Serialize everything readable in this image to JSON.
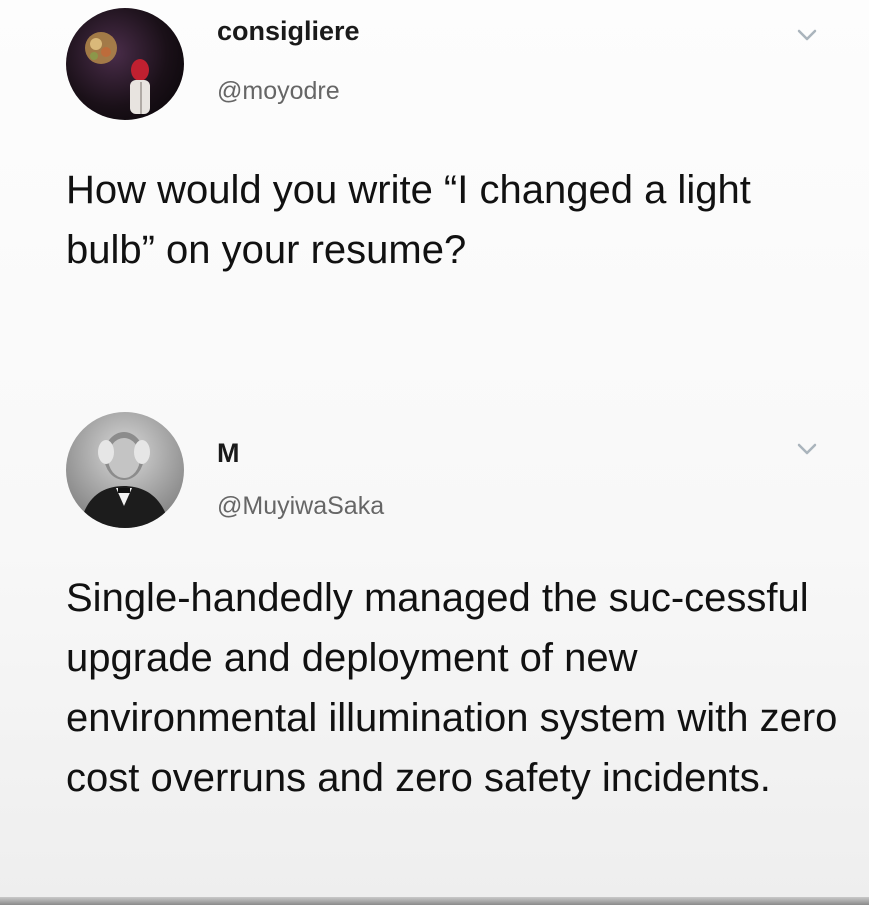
{
  "tweets": [
    {
      "display_name": "consigliere",
      "handle": "@moyodre",
      "text": "How would you write “I changed a light bulb” on your resume?",
      "avatar_icon": "avatar-photo-figure-with-balloon",
      "menu_icon": "chevron-down-icon"
    },
    {
      "display_name": "M",
      "handle": "@MuyiwaSaka",
      "text": "Single-handedly managed the suc-cessful upgrade and deployment of new environmental illumination system with zero cost overruns and zero safety incidents.",
      "avatar_icon": "avatar-photo-portrait",
      "menu_icon": "chevron-down-icon"
    }
  ],
  "colors": {
    "text": "#111111",
    "handle": "#666666",
    "chevron": "#aab4bc"
  }
}
